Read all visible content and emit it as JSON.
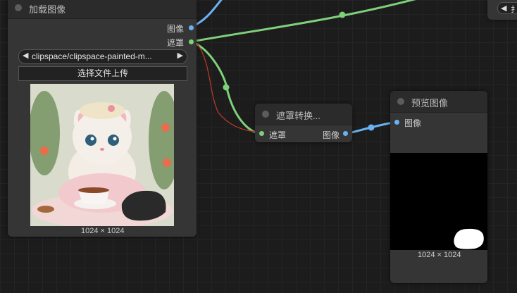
{
  "load_node": {
    "title": "加载图像",
    "output_image_label": "图像",
    "output_mask_label": "遮罩",
    "file_combo": {
      "prev_arrow": "◀",
      "value": "clipspace/clipspace-painted-m...",
      "next_arrow": "▶"
    },
    "upload_button_label": "选择文件上传",
    "image_size": "1024 × 1024"
  },
  "convert_node": {
    "title": "遮罩转换...",
    "input_label": "遮罩",
    "output_label": "图像"
  },
  "preview_node": {
    "title": "预览图像",
    "input_label": "图像",
    "image_size": "1024 × 1024"
  },
  "corner_node": {
    "arrow": "◀",
    "partial_text": "扌"
  },
  "colors": {
    "image_wire": "#6ab3f3",
    "mask_wire": "#7fd07a",
    "link_red": "#c0392b",
    "node_bg": "#353535",
    "title_bg": "#2b2b2b"
  }
}
